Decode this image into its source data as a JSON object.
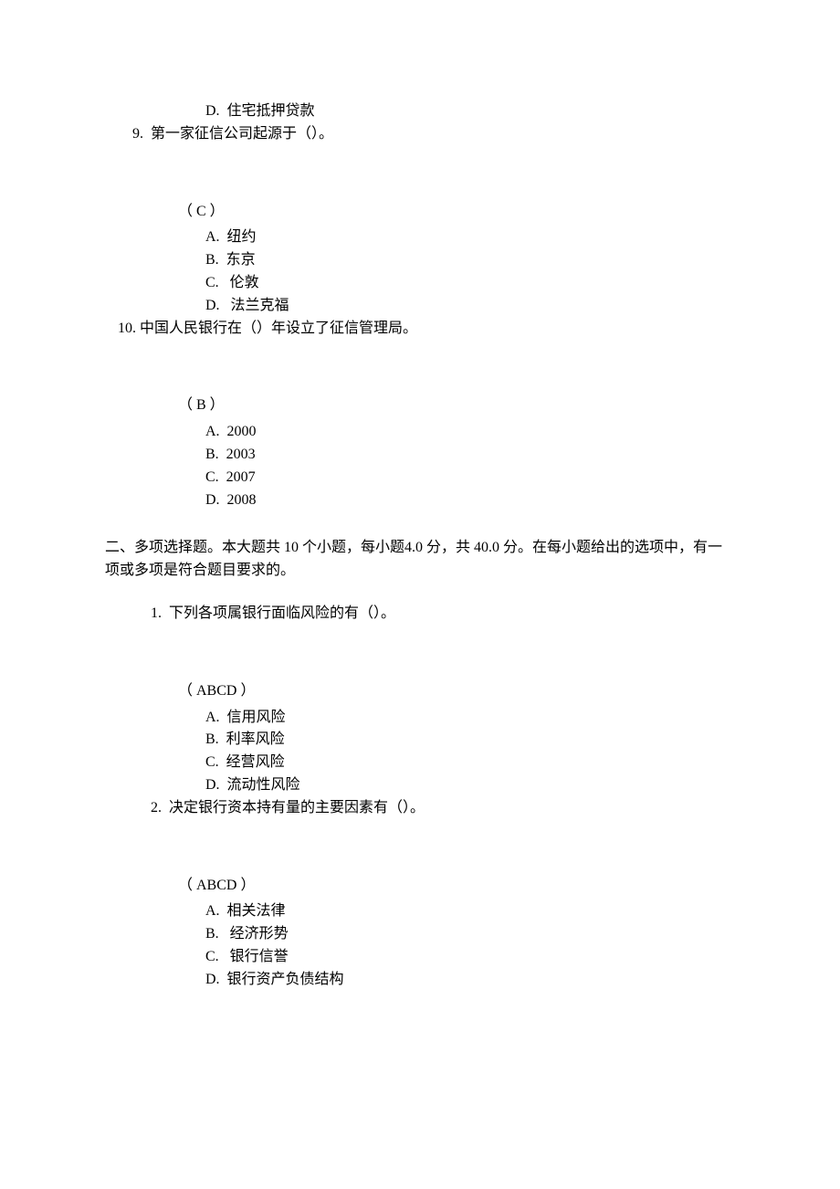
{
  "q8": {
    "option_d": "D.  住宅抵押贷款"
  },
  "q9": {
    "stem": "9.  第一家征信公司起源于（）。",
    "answer": "（ C ）",
    "option_a": "A.  纽约",
    "option_b": "B.  东京",
    "option_c": "C.   伦敦",
    "option_d": "D.   法兰克福"
  },
  "q10": {
    "stem": "10. 中国人民银行在（）年设立了征信管理局。",
    "answer": "（ B ）",
    "option_a": "A.  2000",
    "option_b": "B.  2003",
    "option_c": "C.  2007",
    "option_d": "D.  2008"
  },
  "section2": {
    "header": "二、多项选择题。本大题共 10 个小题，每小题4.0 分，共 40.0 分。在每小题给出的选项中，有一项或多项是符合题目要求的。"
  },
  "sq1": {
    "stem": "1.  下列各项属银行面临风险的有（）。",
    "answer": "（ ABCD ）",
    "option_a": "A.  信用风险",
    "option_b": "B.  利率风险",
    "option_c": "C.  经营风险",
    "option_d": "D.  流动性风险"
  },
  "sq2": {
    "stem": "2.  决定银行资本持有量的主要因素有（）。",
    "answer": "（ ABCD ）",
    "option_a": "A.  相关法律",
    "option_b": "B.   经济形势",
    "option_c": "C.   银行信誉",
    "option_d": "D.  银行资产负债结构"
  }
}
